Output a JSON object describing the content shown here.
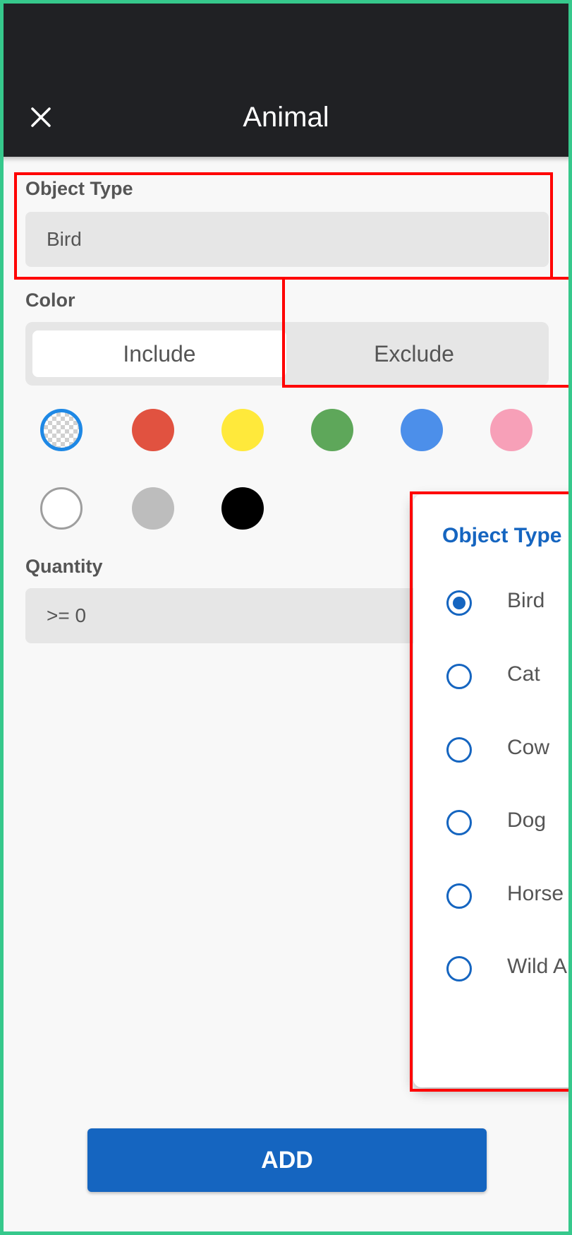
{
  "app_bar": {
    "title": "Animal",
    "close_icon": "close-icon"
  },
  "object_type": {
    "label": "Object Type",
    "value": "Bird"
  },
  "color": {
    "label": "Color",
    "toggle": {
      "include": "Include",
      "exclude": "Exclude",
      "selected": "Include"
    },
    "swatches": [
      {
        "name": "transparent",
        "hex": "checkerboard",
        "selected": true
      },
      {
        "name": "red",
        "hex": "#e15240"
      },
      {
        "name": "yellow",
        "hex": "#ffe93b"
      },
      {
        "name": "green",
        "hex": "#5ea75a"
      },
      {
        "name": "blue",
        "hex": "#4c8fea"
      },
      {
        "name": "pink",
        "hex": "#f7a0b8"
      },
      {
        "name": "white",
        "hex": "#ffffff"
      },
      {
        "name": "gray",
        "hex": "#bdbdbd"
      },
      {
        "name": "black",
        "hex": "#000000"
      }
    ]
  },
  "quantity": {
    "label": "Quantity",
    "value": ">= 0"
  },
  "add_button": {
    "label": "ADD"
  },
  "dialog": {
    "title": "Object Type",
    "options": [
      {
        "label": "Bird",
        "selected": true
      },
      {
        "label": "Cat",
        "selected": false
      },
      {
        "label": "Cow",
        "selected": false
      },
      {
        "label": "Dog",
        "selected": false
      },
      {
        "label": "Horse",
        "selected": false
      },
      {
        "label": "Wild A",
        "selected": false
      }
    ]
  },
  "colors": {
    "accent": "#1565c0",
    "app_bar_bg": "#202124",
    "highlight": "#ff0000",
    "frame": "#36c88c"
  }
}
